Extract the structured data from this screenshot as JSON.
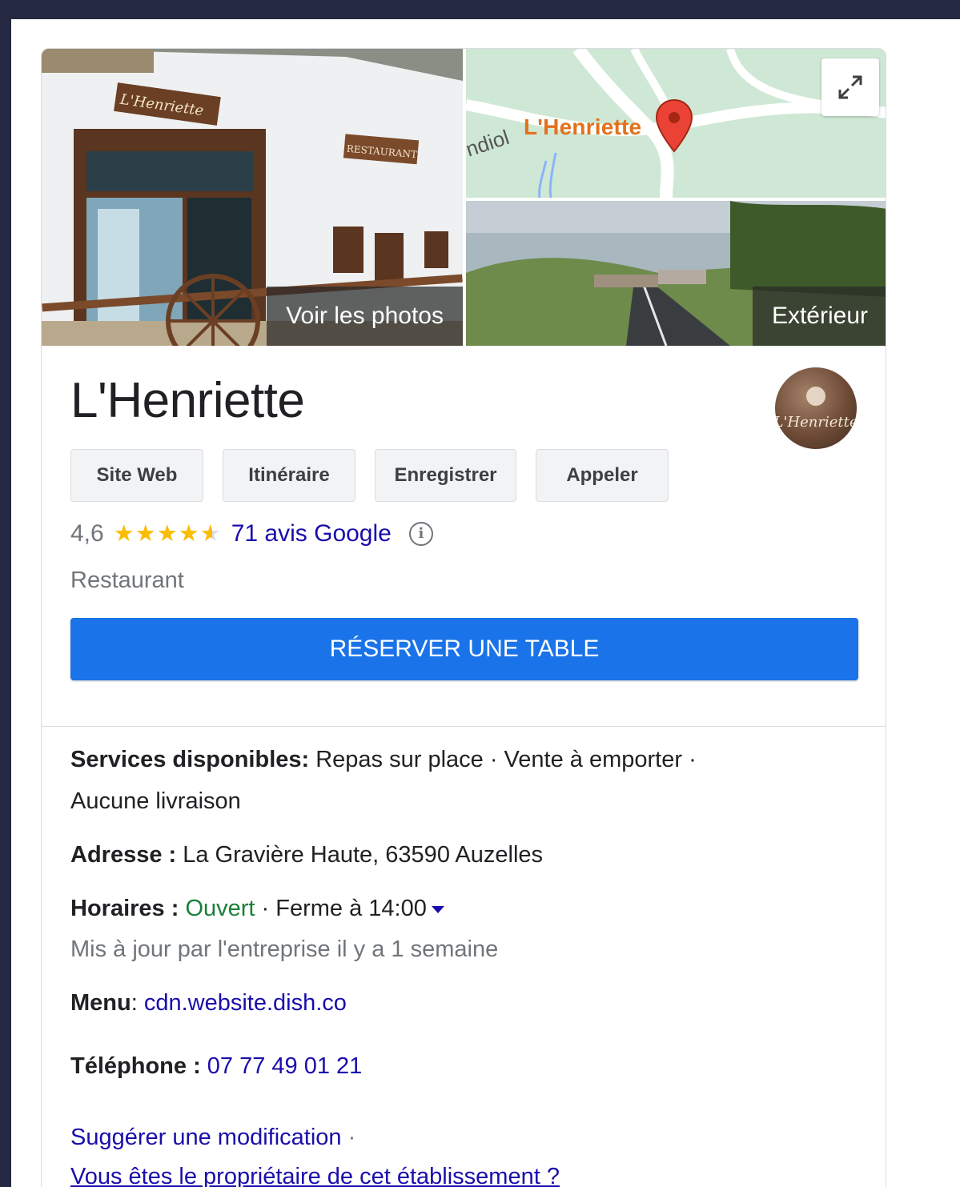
{
  "media": {
    "photos_caption": "Voir les photos",
    "map_label": "L'Henriette",
    "map_partial_label": "ndiol",
    "street_caption": "Extérieur",
    "sign_text": "L'Henriette",
    "sign_restaurant": "RESTAURANT"
  },
  "business": {
    "name": "L'Henriette",
    "logo_text": "L'Henriette",
    "category": "Restaurant"
  },
  "actions": {
    "website": "Site Web",
    "directions": "Itinéraire",
    "save": "Enregistrer",
    "call": "Appeler"
  },
  "rating": {
    "value": "4,6",
    "stars_filled": 4.6,
    "reviews": "71 avis Google"
  },
  "reserve": {
    "label": "RÉSERVER UNE TABLE"
  },
  "details": {
    "services_label": "Services disponibles:",
    "services_line1": " Repas sur place · Vente à emporter ·",
    "services_line2": "Aucune livraison",
    "address_label": "Adresse :",
    "address_value": " La Gravière Haute, 63590 Auzelles",
    "hours_label": "Horaires :",
    "hours_status": " Ouvert",
    "hours_close": " · Ferme à 14:00",
    "hours_updated": "Mis à jour par l'entreprise il y a 1 semaine",
    "menu_label": "Menu",
    "menu_sep": ": ",
    "menu_link": "cdn.website.dish.co",
    "phone_label": "Téléphone :",
    "phone_value": " 07 77 49 01 21",
    "suggest_link": "Suggérer une modification",
    "suggest_sep": " ·",
    "owner_link": "Vous êtes le propriétaire de cet établissement ?"
  },
  "colors": {
    "accent": "#1a73e8",
    "link": "#1a0dab",
    "open": "#188038",
    "star": "#fbbc04",
    "frame": "#252a42"
  }
}
